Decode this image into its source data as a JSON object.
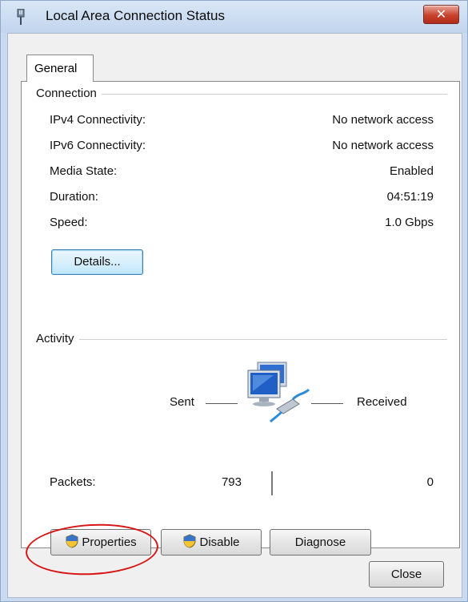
{
  "window": {
    "title": "Local Area Connection Status",
    "close_glyph": "✕"
  },
  "tabs": [
    {
      "label": "General"
    }
  ],
  "connection": {
    "section_label": "Connection",
    "rows": [
      {
        "label": "IPv4 Connectivity:",
        "value": "No network access"
      },
      {
        "label": "IPv6 Connectivity:",
        "value": "No network access"
      },
      {
        "label": "Media State:",
        "value": "Enabled"
      },
      {
        "label": "Duration:",
        "value": "04:51:19"
      },
      {
        "label": "Speed:",
        "value": "1.0 Gbps"
      }
    ],
    "details_button": "Details..."
  },
  "activity": {
    "section_label": "Activity",
    "sent_label": "Sent",
    "received_label": "Received",
    "packets_label": "Packets:",
    "packets_sent": "793",
    "packets_received": "0",
    "icon": "network-computers-icon"
  },
  "buttons": {
    "properties": "Properties",
    "disable": "Disable",
    "diagnose": "Diagnose",
    "close": "Close"
  },
  "colors": {
    "highlight_ellipse": "#d81414",
    "focus_accent": "#3c7fb1"
  }
}
